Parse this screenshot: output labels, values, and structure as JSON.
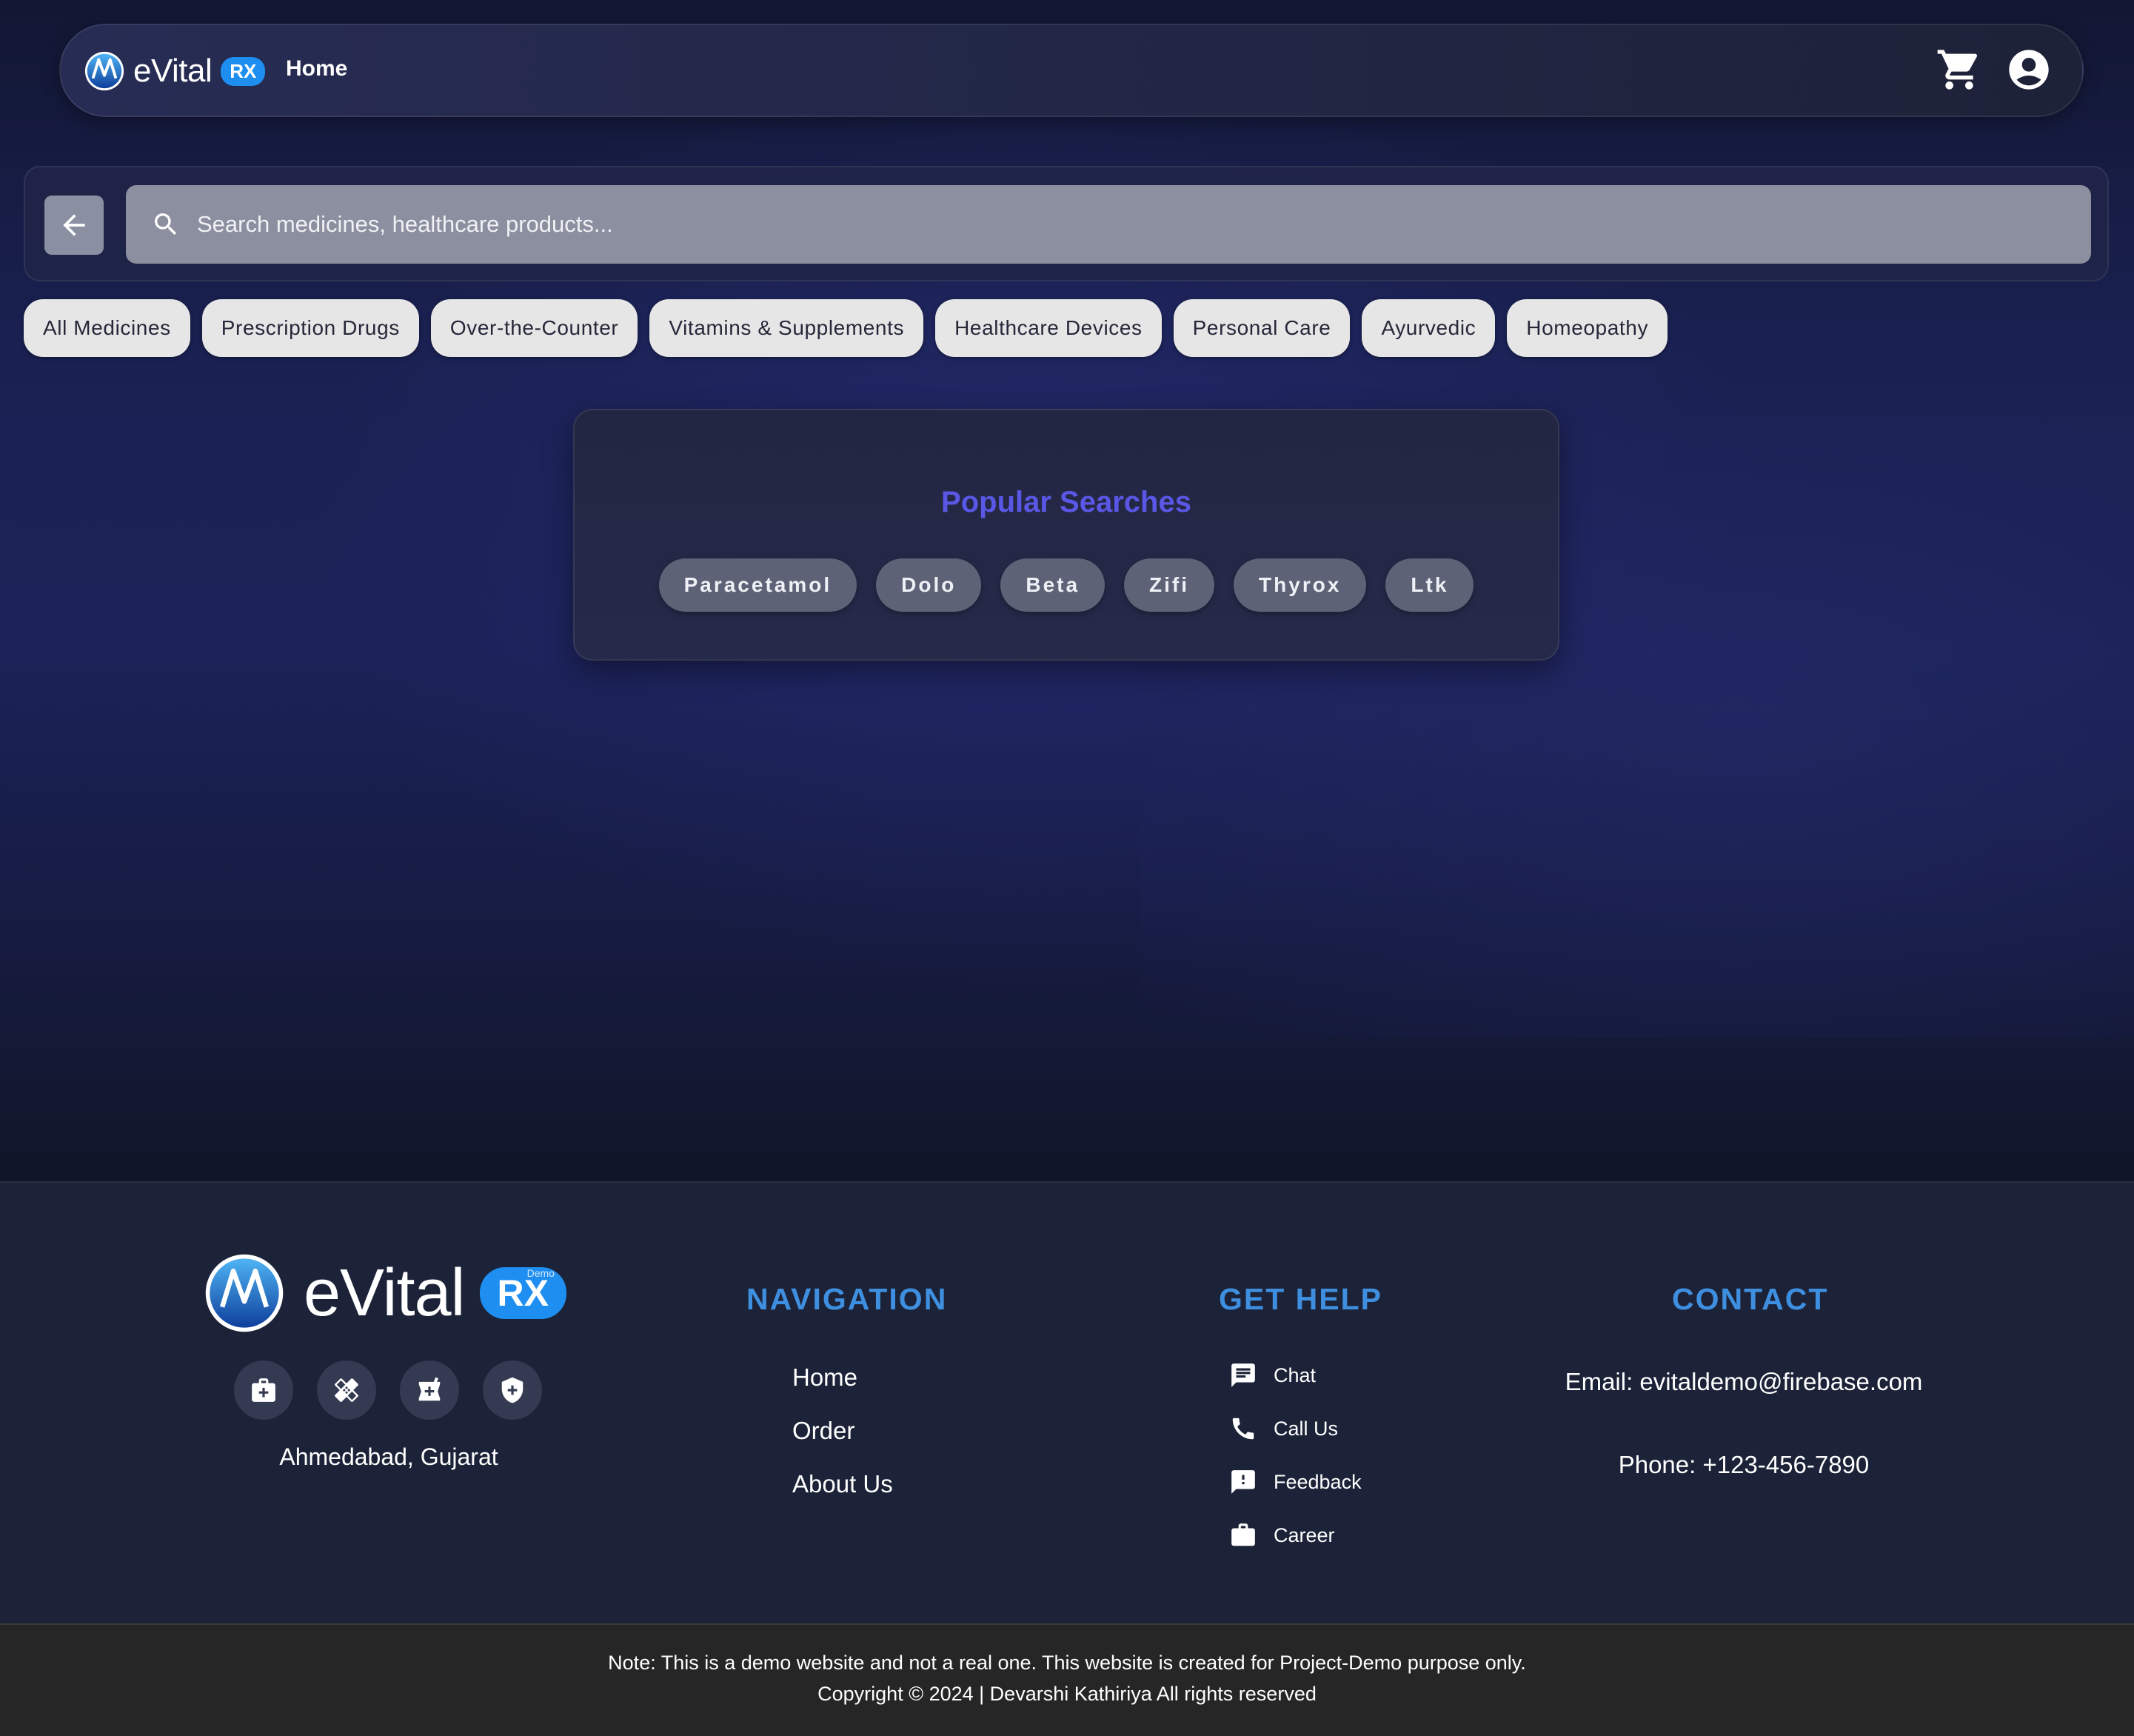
{
  "colors": {
    "accent_blue": "#3f8fe0",
    "brand_rx": "#1e8ff0",
    "popular_title": "#5a57e6",
    "chip_bg": "#e6e6e6",
    "pill_bg": "#5d6276"
  },
  "header": {
    "brand_word": "eVital",
    "brand_badge": "RX",
    "nav_home": "Home",
    "icons": [
      "cart-icon",
      "account-icon"
    ]
  },
  "search": {
    "back_icon": "arrow-left-icon",
    "placeholder": "Search medicines, healthcare products...",
    "value": ""
  },
  "categories": [
    "All Medicines",
    "Prescription Drugs",
    "Over-the-Counter",
    "Vitamins & Supplements",
    "Healthcare Devices",
    "Personal Care",
    "Ayurvedic",
    "Homeopathy"
  ],
  "popular": {
    "title": "Popular Searches",
    "items": [
      "Paracetamol",
      "Dolo",
      "Beta",
      "Zifi",
      "Thyrox",
      "Ltk"
    ]
  },
  "footer": {
    "brand_word": "eVital",
    "brand_badge": "RX",
    "brand_badge_sub": "Demo",
    "social_icons": [
      "medical-kit-icon",
      "bandage-icon",
      "pharmacy-icon",
      "health-shield-icon"
    ],
    "location": "Ahmedabad, Gujarat",
    "navigation": {
      "heading": "NAVIGATION",
      "links": [
        "Home",
        "Order",
        "About Us"
      ]
    },
    "help": {
      "heading": "GET HELP",
      "items": [
        {
          "label": "Chat",
          "icon": "chat-icon"
        },
        {
          "label": "Call Us",
          "icon": "phone-icon"
        },
        {
          "label": "Feedback",
          "icon": "feedback-icon"
        },
        {
          "label": "Career",
          "icon": "briefcase-icon"
        }
      ]
    },
    "contact": {
      "heading": "CONTACT",
      "email": "Email: evitaldemo@firebase.com",
      "phone": "Phone: +123-456-7890"
    },
    "note": "Note: This is a demo website and not a real one. This website is created for Project-Demo purpose only.",
    "copyright": "Copyright © 2024 | Devarshi Kathiriya All rights reserved"
  }
}
